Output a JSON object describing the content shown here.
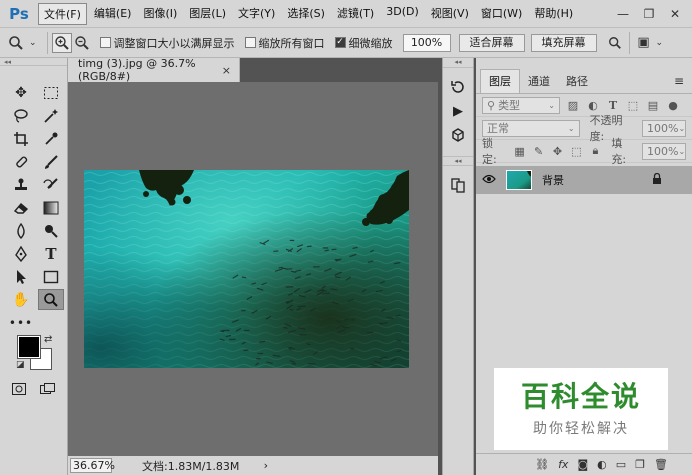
{
  "app": {
    "logo": "Ps"
  },
  "menubar": {
    "items": [
      "文件(F)",
      "编辑(E)",
      "图像(I)",
      "图层(L)",
      "文字(Y)",
      "选择(S)",
      "滤镜(T)",
      "3D(D)",
      "视图(V)",
      "窗口(W)",
      "帮助(H)"
    ],
    "active_index": 0
  },
  "options": {
    "resize_windows_label": "调整窗口大小以满屏显示",
    "zoom_all_label": "缩放所有窗口",
    "scrubby_zoom_label": "细微缩放",
    "zoom_value": "100%",
    "fit_screen_label": "适合屏幕",
    "fill_screen_label": "填充屏幕",
    "scrubby_checked": true
  },
  "document": {
    "tab_title": "timg (3).jpg @ 36.7%(RGB/8#)",
    "close_glyph": "×",
    "zoom": "36.67%",
    "doc_info": "文档:1.83M/1.83M",
    "status_arrow": "›"
  },
  "layers_panel": {
    "tabs": [
      "图层",
      "通道",
      "路径"
    ],
    "active_tab": 0,
    "filter_label": "类型",
    "blend_mode": "正常",
    "opacity_label": "不透明度:",
    "opacity_value": "100%",
    "lock_label": "锁定:",
    "fill_label": "填充:",
    "fill_value": "100%",
    "layer": {
      "name": "背景",
      "locked": true
    },
    "bottom_icons": [
      "link-icon",
      "fx-icon",
      "mask-icon",
      "adjustment-icon",
      "folder-icon",
      "new-layer-icon",
      "trash-icon"
    ],
    "fx_text": "fx"
  },
  "watermark": {
    "title": "百科全说",
    "subtitle": "助你轻松解决"
  },
  "colors": {
    "ps_blue": "#1f6fb5",
    "watermark_green": "#2e8b2e",
    "panel_bg": "#d6d6d6",
    "canvas_bg": "#6e6e6e"
  }
}
